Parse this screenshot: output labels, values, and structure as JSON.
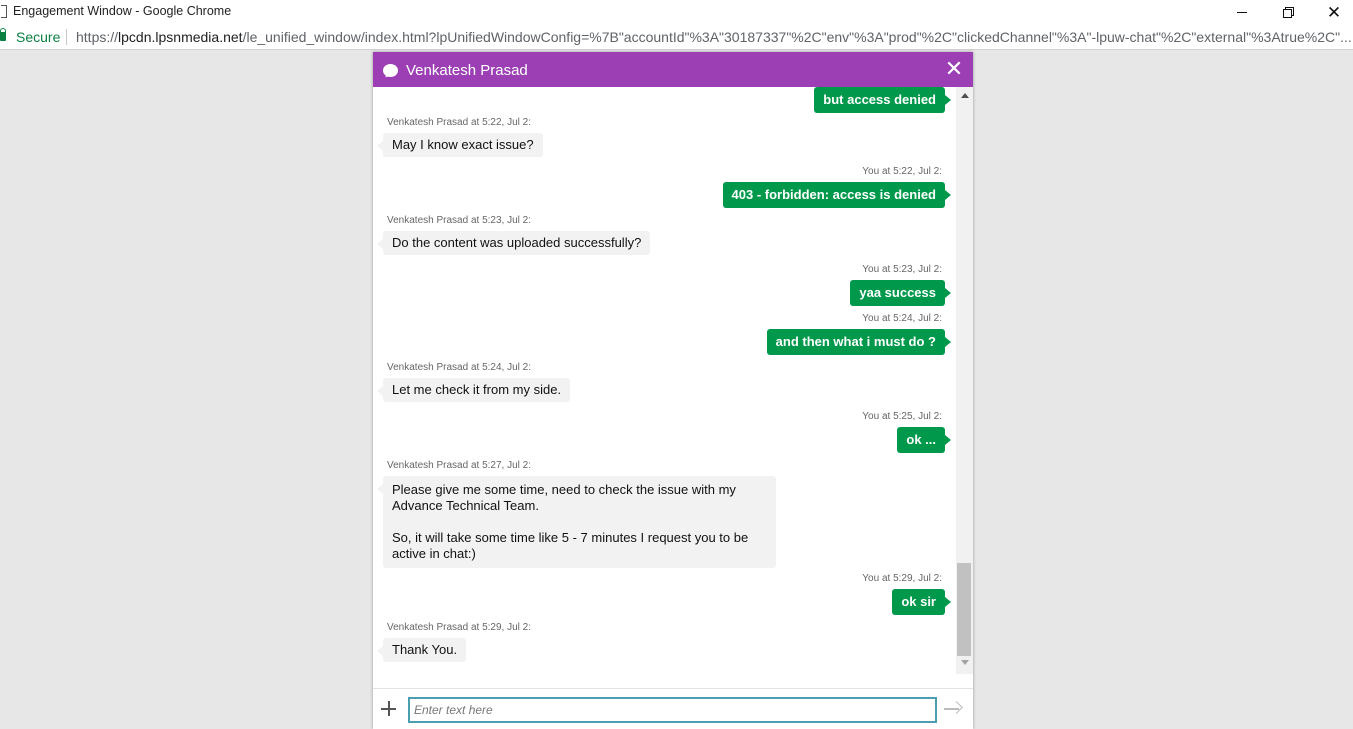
{
  "browser": {
    "window_title": "Engagement Window - Google Chrome",
    "secure_label": "Secure",
    "url_scheme": "https://",
    "url_host": "lpcdn.lpsnmedia.net",
    "url_rest": "/le_unified_window/index.html?lpUnifiedWindowConfig=%7B\"accountId\"%3A\"30187337\"%2C\"env\"%3A\"prod\"%2C\"clickedChannel\"%3A\"-lpuw-chat\"%2C\"external\"%3Atrue%2C\"..."
  },
  "chat": {
    "agent_name": "Venkatesh Prasad",
    "header_color": "#9c3fb4",
    "agent_bubble_color": "#f2f2f2",
    "you_bubble_color": "#00994c",
    "messages": [
      {
        "sender": "you",
        "meta": "",
        "text": "but access denied"
      },
      {
        "sender": "agent",
        "meta": "Venkatesh Prasad at 5:22, Jul 2:",
        "text": "May I know exact issue?"
      },
      {
        "sender": "you",
        "meta": "You at 5:22, Jul 2:",
        "text": "403 - forbidden: access is denied"
      },
      {
        "sender": "agent",
        "meta": "Venkatesh Prasad at 5:23, Jul 2:",
        "text": "Do the content was uploaded successfully?"
      },
      {
        "sender": "you",
        "meta": "You at 5:23, Jul 2:",
        "text": "yaa success"
      },
      {
        "sender": "you",
        "meta": "You at 5:24, Jul 2:",
        "text": "and then what i must do ?"
      },
      {
        "sender": "agent",
        "meta": "Venkatesh Prasad at 5:24, Jul 2:",
        "text": "Let me check it from my side."
      },
      {
        "sender": "you",
        "meta": "You at 5:25, Jul 2:",
        "text": "ok ..."
      },
      {
        "sender": "agent",
        "meta": "Venkatesh Prasad at 5:27, Jul 2:",
        "text_lines": [
          "Please give me some time, need to check the issue with my",
          "Advance Technical Team.",
          "",
          "So, it will take some time like 5 - 7 minutes I request you to be",
          "active in chat:)"
        ]
      },
      {
        "sender": "you",
        "meta": "You at 5:29, Jul 2:",
        "text": "ok sir"
      },
      {
        "sender": "agent",
        "meta": "Venkatesh Prasad at 5:29, Jul 2:",
        "text": "Thank You."
      }
    ],
    "input_placeholder": "Enter text here"
  }
}
